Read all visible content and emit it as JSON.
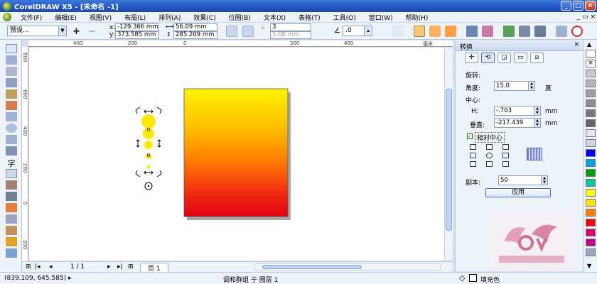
{
  "window": {
    "title": "CorelDRAW X5 - [未命名 -1]"
  },
  "menu": [
    "文件(F)",
    "编辑(E)",
    "视图(V)",
    "布局(L)",
    "排列(A)",
    "效果(C)",
    "位图(B)",
    "文本(X)",
    "表格(T)",
    "工具(O)",
    "窗口(W)",
    "帮助(H)"
  ],
  "propbar": {
    "preset": "预设...",
    "x": "-129.366 mm",
    "y": "373.585 mm",
    "x_label": "x:",
    "y_label": "y:",
    "w": "56.09 mm",
    "h": "285.209 mm",
    "steps": "3",
    "spacing": "5.08 mm",
    "angle": ".0"
  },
  "rulers": {
    "h_ticks": [
      "400",
      "200",
      "0",
      "200",
      "400"
    ],
    "v_ticks": [
      "800",
      "600",
      "400",
      "200",
      "0",
      "200"
    ],
    "unit": "毫米"
  },
  "bottombar": {
    "page_info": "1 / 1",
    "page_tab": "页 1"
  },
  "status": {
    "coords": "(839.109, 645.585)",
    "message": "调和群组 于 图层 1",
    "fill_label": "填充色"
  },
  "docker": {
    "title": "转换",
    "section_rotate": "旋转:",
    "angle_label": "角度:",
    "angle_value": "15.0",
    "angle_unit": "度",
    "center_label": "中心:",
    "h_label": "H:",
    "h_value": "-.703",
    "h_unit": "mm",
    "v_label": "垂直:",
    "v_value": "-217.439",
    "v_unit": "mm",
    "relative_center": "相对中心",
    "copies_label": "副本:",
    "copies_value": "50",
    "apply": "应用"
  },
  "palette_colors": [
    "#ffffff",
    "#000000",
    "#c8c8c8",
    "#b4b4b4",
    "#a0a0a0",
    "#8c8c8c",
    "#787878",
    "#646464",
    "#e6e6f0",
    "#d2d2e6",
    "#0000ff",
    "#00a0e0",
    "#00a000",
    "#00c8a0",
    "#ffff00",
    "#ffe000",
    "#ff8000",
    "#ff0000",
    "#e00070",
    "#c80090",
    "#a0a0c8"
  ],
  "accent": "#2457c5"
}
